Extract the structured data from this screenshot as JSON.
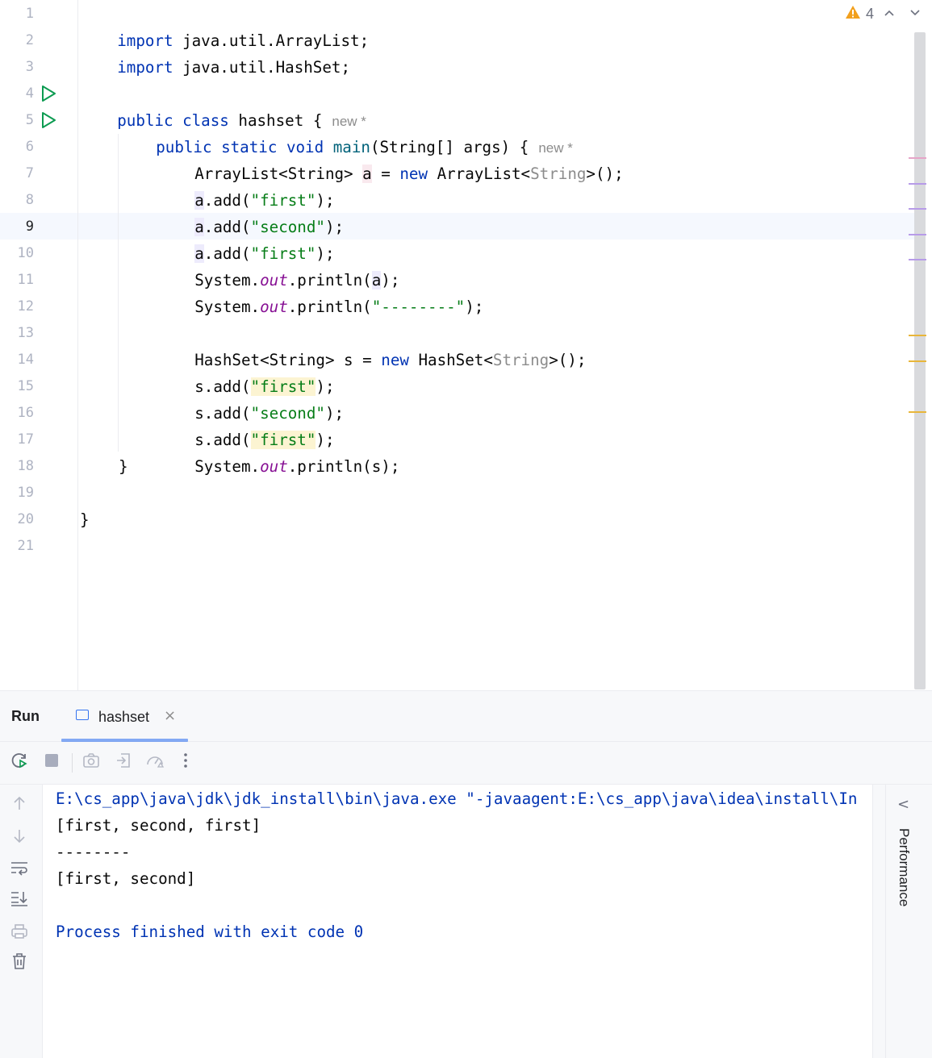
{
  "editor": {
    "line_numbers": [
      "1",
      "2",
      "3",
      "4",
      "5",
      "6",
      "7",
      "8",
      "9",
      "10",
      "11",
      "12",
      "13",
      "14",
      "15",
      "16",
      "17",
      "18",
      "19",
      "20",
      "21"
    ],
    "current_line": "9",
    "inspections": {
      "warning_count": "4",
      "prev_label": "^",
      "next_label": "v"
    },
    "code": {
      "l1": {
        "kw": "import",
        "rest": " java.util.ArrayList;"
      },
      "l2": {
        "kw": "import",
        "rest": " java.util.HashSet;"
      },
      "l4": {
        "kw": "public class",
        "name": " hashset",
        "brace": " {",
        "hint": "new *"
      },
      "l5": {
        "kw": "public static void",
        "method": "main",
        "rest": "(String[] args) {",
        "hint": "new *"
      },
      "l6": {
        "t1": "ArrayList<String> ",
        "var": "a",
        "t2": " = ",
        "kw": "new",
        "t3": " ArrayList<",
        "gen": "String",
        "t4": ">();"
      },
      "l7": {
        "var": "a",
        "call": ".add(",
        "str": "\"first\"",
        "end": ");"
      },
      "l8": {
        "var": "a",
        "call": ".add(",
        "str": "\"second\"",
        "end": ");"
      },
      "l9": {
        "var": "a",
        "call": ".add(",
        "str": "\"first\"",
        "end": ");"
      },
      "l10": {
        "sys": "System.",
        "out": "out",
        "call": ".println(",
        "arg": "a",
        "end": ");"
      },
      "l11": {
        "sys": "System.",
        "out": "out",
        "call": ".println(",
        "str": "\"--------\"",
        "end": ");"
      },
      "l13": {
        "t1": "HashSet<String> s = ",
        "kw": "new",
        "t3": " HashSet<",
        "gen": "String",
        "t4": ">();"
      },
      "l14": {
        "var": "s",
        "call": ".add(",
        "str": "\"first\"",
        "end": ");"
      },
      "l15": {
        "var": "s",
        "call": ".add(",
        "str": "\"second\"",
        "end": ");"
      },
      "l16": {
        "var": "s",
        "call": ".add(",
        "str": "\"first\"",
        "end": ");"
      },
      "l17": {
        "sys": "System.",
        "out": "out",
        "call": ".println(s);"
      },
      "l18": "}",
      "l20": "}"
    }
  },
  "run_window": {
    "title": "Run",
    "tab_label": "hashset",
    "tab_close": "×",
    "output": [
      "E:\\cs_app\\java\\jdk\\jdk_install\\bin\\java.exe \"-javaagent:E:\\cs_app\\java\\idea\\install\\In",
      "[first, second, first]",
      "--------",
      "[first, second]",
      "",
      "Process finished with exit code 0"
    ],
    "side_panel": {
      "collapse": "<",
      "label": "Performance"
    }
  },
  "colors": {
    "keyword": "#0033b3",
    "string": "#067d17",
    "static_field": "#871094",
    "run_icon": "#0c9b51",
    "warning": "#f2a01d",
    "accent": "#3574f0"
  },
  "icons": [
    "run-gutter-icon",
    "warning-icon",
    "rerun-icon",
    "stop-icon",
    "screenshot-icon",
    "restore-layout-icon",
    "profiler-icon",
    "more-icon",
    "arrow-up-icon",
    "arrow-down-icon",
    "soft-wrap-icon",
    "scroll-to-end-icon",
    "print-icon",
    "trash-icon",
    "console-tab-icon"
  ]
}
